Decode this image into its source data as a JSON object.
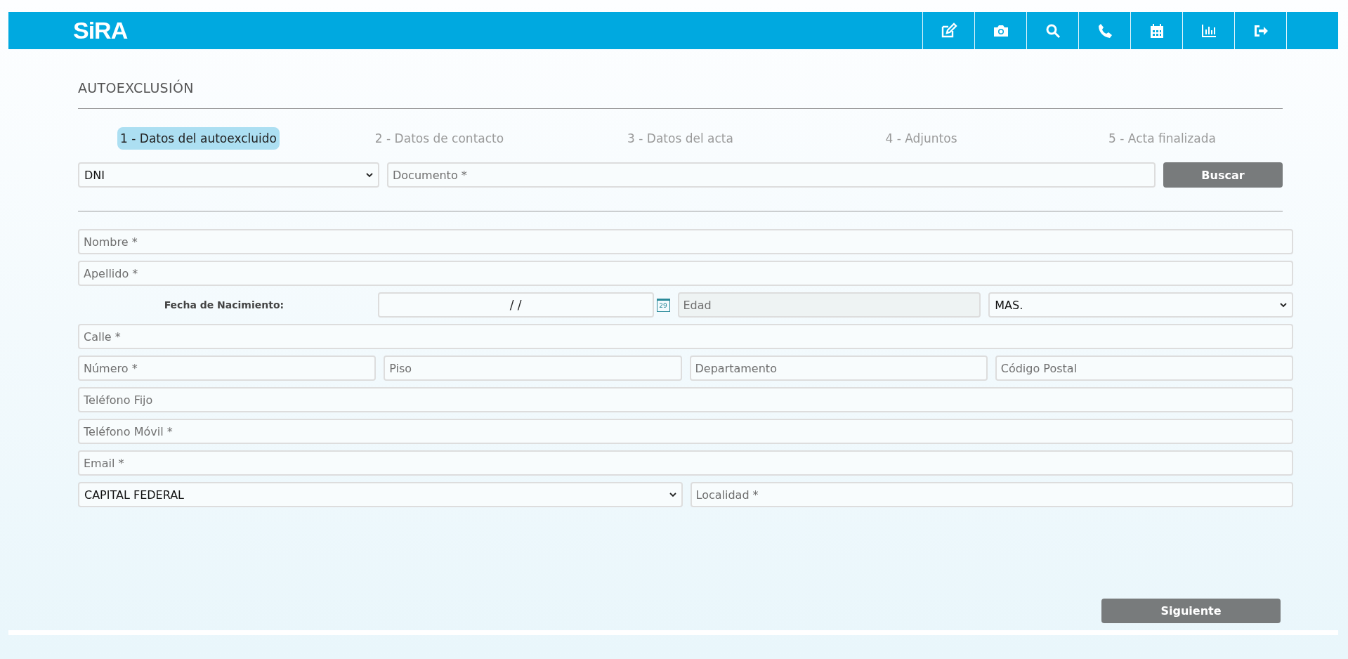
{
  "header": {
    "logo": "SiRA"
  },
  "page": {
    "title": "AUTOEXCLUSIÓN"
  },
  "steps": [
    {
      "label": "1 - Datos del autoexcluido",
      "selected": true
    },
    {
      "label": "2 - Datos de contacto",
      "selected": false
    },
    {
      "label": "3 - Datos del acta",
      "selected": false
    },
    {
      "label": "4 - Adjuntos",
      "selected": false
    },
    {
      "label": "5 - Acta finalizada",
      "selected": false
    }
  ],
  "search": {
    "document_type": "DNI",
    "document": {
      "placeholder": "Documento *"
    },
    "button": "Buscar"
  },
  "form_rows": [
    [
      {
        "kind": "input",
        "placeholder": "Nombre *"
      }
    ],
    [
      {
        "kind": "input",
        "placeholder": "Apellido *"
      }
    ],
    [
      {
        "kind": "label",
        "text": "Fecha de Nacimiento:"
      },
      {
        "kind": "date",
        "value": "/ /",
        "calendar_day": "29"
      },
      {
        "kind": "input",
        "placeholder": "Edad",
        "disabled": true
      },
      {
        "kind": "select",
        "value": "MAS."
      }
    ],
    [
      {
        "kind": "input",
        "placeholder": "Calle *"
      }
    ],
    [
      {
        "kind": "input",
        "placeholder": "Número *"
      },
      {
        "kind": "input",
        "placeholder": "Piso"
      },
      {
        "kind": "input",
        "placeholder": "Departamento"
      },
      {
        "kind": "input",
        "placeholder": "Código Postal"
      }
    ],
    [
      {
        "kind": "input",
        "placeholder": "Teléfono Fijo"
      }
    ],
    [
      {
        "kind": "input",
        "placeholder": "Teléfono Móvil *"
      }
    ],
    [
      {
        "kind": "input",
        "placeholder": "Email *"
      }
    ],
    [
      {
        "kind": "select",
        "value": "CAPITAL FEDERAL"
      },
      {
        "kind": "input",
        "placeholder": "Localidad *"
      }
    ]
  ],
  "next_button": "Siguiente"
}
